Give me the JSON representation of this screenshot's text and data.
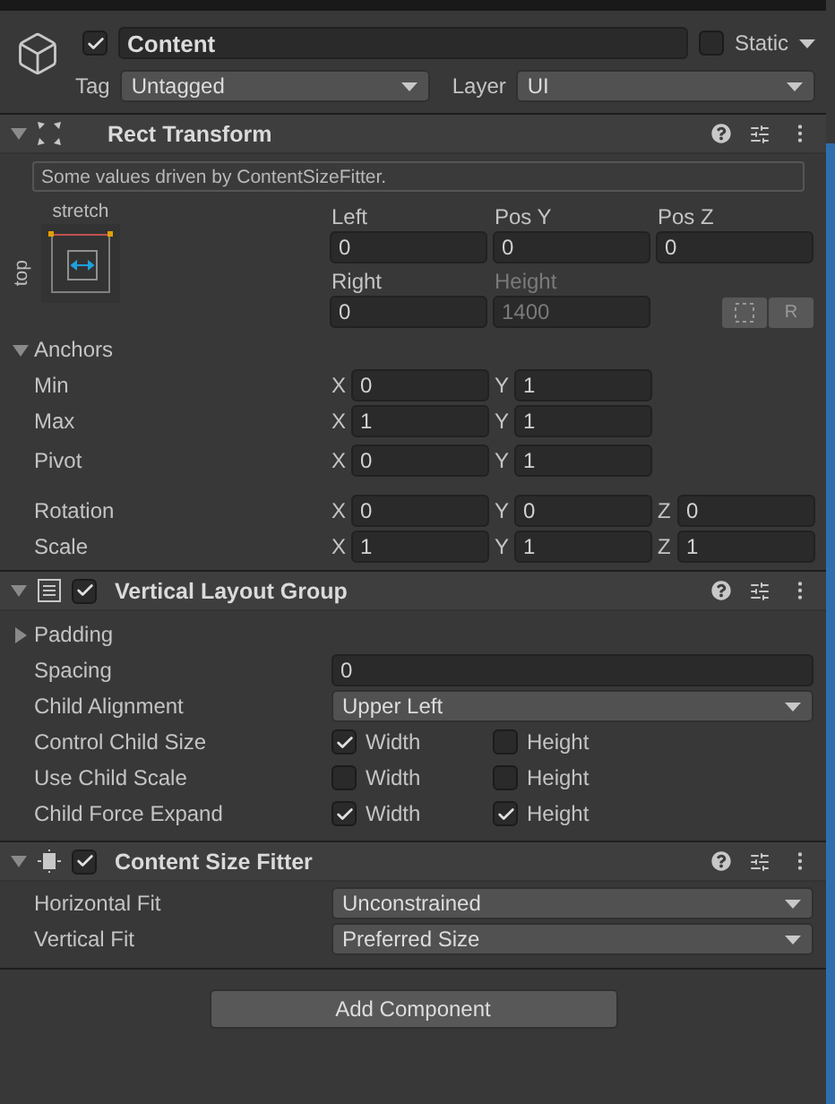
{
  "game_object": {
    "active": true,
    "name": "Content",
    "static": false,
    "static_label": "Static",
    "tag_label": "Tag",
    "tag": "Untagged",
    "layer_label": "Layer",
    "layer": "UI"
  },
  "rect_transform": {
    "title": "Rect Transform",
    "expanded": true,
    "info": "Some values driven by ContentSizeFitter.",
    "anchor_preset": {
      "horizontal": "stretch",
      "vertical": "top"
    },
    "position_fields": [
      {
        "label": "Left",
        "value": "0",
        "disabled": false
      },
      {
        "label": "Pos Y",
        "value": "0",
        "disabled": false
      },
      {
        "label": "Pos Z",
        "value": "0",
        "disabled": false
      },
      {
        "label": "Right",
        "value": "0",
        "disabled": false
      },
      {
        "label": "Height",
        "value": "1400",
        "disabled": true
      }
    ],
    "raw_edit_button": "R",
    "anchors": {
      "label": "Anchors",
      "expanded": true,
      "rows": [
        {
          "label": "Min",
          "values": [
            {
              "axis": "X",
              "value": "0"
            },
            {
              "axis": "Y",
              "value": "1"
            }
          ]
        },
        {
          "label": "Max",
          "values": [
            {
              "axis": "X",
              "value": "1"
            },
            {
              "axis": "Y",
              "value": "1"
            }
          ]
        }
      ]
    },
    "pivot": {
      "label": "Pivot",
      "values": [
        {
          "axis": "X",
          "value": "0"
        },
        {
          "axis": "Y",
          "value": "1"
        }
      ]
    },
    "transform_rows": [
      {
        "label": "Rotation",
        "values": [
          {
            "axis": "X",
            "value": "0"
          },
          {
            "axis": "Y",
            "value": "0"
          },
          {
            "axis": "Z",
            "value": "0"
          }
        ]
      },
      {
        "label": "Scale",
        "values": [
          {
            "axis": "X",
            "value": "1"
          },
          {
            "axis": "Y",
            "value": "1"
          },
          {
            "axis": "Z",
            "value": "1"
          }
        ]
      }
    ]
  },
  "vertical_layout_group": {
    "title": "Vertical Layout Group",
    "enabled": true,
    "expanded": true,
    "padding": {
      "label": "Padding",
      "expanded": false
    },
    "spacing": {
      "label": "Spacing",
      "value": "0"
    },
    "child_alignment": {
      "label": "Child Alignment",
      "value": "Upper Left"
    },
    "toggle_rows": [
      {
        "label": "Control Child Size",
        "options": [
          {
            "label": "Width",
            "checked": true
          },
          {
            "label": "Height",
            "checked": false
          }
        ]
      },
      {
        "label": "Use Child Scale",
        "options": [
          {
            "label": "Width",
            "checked": false
          },
          {
            "label": "Height",
            "checked": false
          }
        ]
      },
      {
        "label": "Child Force Expand",
        "options": [
          {
            "label": "Width",
            "checked": true
          },
          {
            "label": "Height",
            "checked": true
          }
        ]
      }
    ]
  },
  "content_size_fitter": {
    "title": "Content Size Fitter",
    "enabled": true,
    "expanded": true,
    "fields": [
      {
        "label": "Horizontal Fit",
        "value": "Unconstrained"
      },
      {
        "label": "Vertical Fit",
        "value": "Preferred Size"
      }
    ]
  },
  "add_component_button": "Add Component"
}
